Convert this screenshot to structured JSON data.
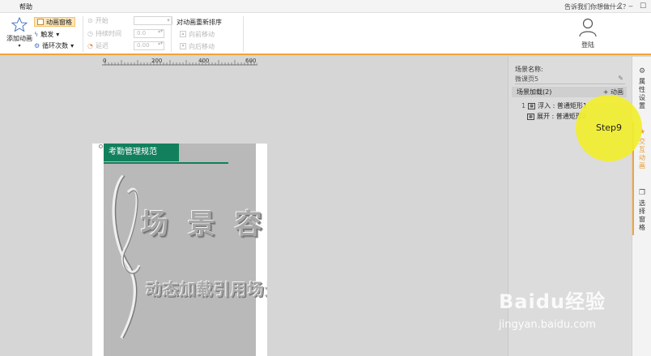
{
  "menu": {
    "tab_help": "帮助",
    "tell_me": "告诉我们你想做什么？",
    "help_icon": "?",
    "minimize_icon": "‒",
    "maximize_icon": "☐",
    "close_icon": "✕"
  },
  "ribbon": {
    "add_animation": "添加动画",
    "animation_pane": "动画窗格",
    "trigger": "触发",
    "loop_count": "循环次数",
    "start": "开始",
    "duration": "持续时间",
    "duration_value": "0.0",
    "delay": "延迟",
    "delay_value": "0.00",
    "reorder_title": "对动画重新排序",
    "move_earlier": "向前移动",
    "move_later": "向后移动",
    "login": "登陆"
  },
  "ruler": {
    "ticks": [
      "0",
      "200",
      "400",
      "600"
    ]
  },
  "slide": {
    "header": "考勤管理规范",
    "emboss_title": "场 景 容 器",
    "emboss_subtitle": "动态加载引用场景"
  },
  "panel": {
    "scene_name_label": "场景名称:",
    "scene_name_value": "微课页5",
    "scene_load_label": "场景加载(2)",
    "add_animation": "+ 动画",
    "items": [
      {
        "index": "1",
        "text": "浮入 : 普通矩形1"
      },
      {
        "index": "",
        "text": "展开 : 普通矩形2"
      }
    ]
  },
  "side_tabs": {
    "properties": "属性设置",
    "interactive_animation": "交互动画",
    "selection_pane": "选择窗格"
  },
  "overlay": {
    "step": "Step9"
  },
  "watermark": {
    "logo": "Baidu经验",
    "url": "jingyan.baidu.com"
  },
  "colors": {
    "accent": "#f0a53a",
    "slide_header": "#12805c",
    "step_highlight": "#f2ee2e"
  }
}
